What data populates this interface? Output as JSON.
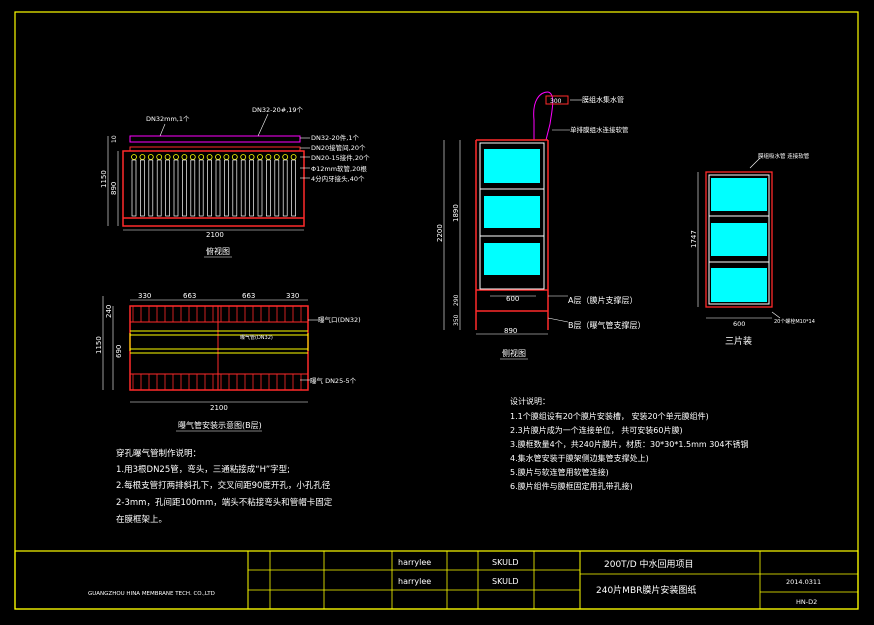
{
  "colors": {
    "frame": "#ffff00",
    "structure": "#ff2a2a",
    "text": "#ffffff",
    "membrane": "#00ffff",
    "dim": "#ffffff",
    "pipe": "#ff00ff"
  },
  "front_view": {
    "callouts": [
      "DN32mm,1个",
      "DN32-20#,19个",
      "DN32-20件,1个",
      "DN20接管间,20个",
      "DN20-15接件,20个",
      "Φ12mm软管,20根",
      "4分内牙接头,40个"
    ],
    "dim_width": "2100",
    "dim_height_outer": "1150",
    "dim_height_inner": "890",
    "dim_small": "10",
    "caption": "俯视图"
  },
  "plan_view": {
    "dims_top": [
      "330",
      "663",
      "663",
      "330"
    ],
    "dim_width": "2100",
    "dims_left": [
      "240",
      "1150",
      "690"
    ],
    "label_inlet": "曝气口(DN32)",
    "label_inner": "曝气管(DN32)",
    "label_bottom": "曝气 DN25-5个",
    "caption": "曝气管安装示意图(B层)"
  },
  "aeration_notes": {
    "title": "穿孔曝气管制作说明：",
    "lines": [
      "1.用3根DN25管，弯头，三通粘接成“H”字型;",
      "2.每根支管打两排斜孔下，交叉间距90度开孔，小孔孔径",
      "2-3mm，孔间距100mm，端头不粘接弯头和管帽卡固定",
      "在膜框架上。"
    ]
  },
  "side_view": {
    "label_top_dim": "300",
    "label_pipe": "膜组水集水管",
    "label_connector": "单排膜组水连接软管",
    "dim_total": "2200",
    "dim_upper": "1890",
    "dim_lower": "290",
    "dim_lower_small": "350",
    "dim_width_inner": "600",
    "dim_width_outer": "890",
    "label_layer_a": "A层（膜片支撑层）",
    "label_layer_b": "B层（曝气管支撑层）",
    "caption": "侧视图"
  },
  "three_panel": {
    "callout_top": "膜组吸水管\n连接软管",
    "dim_height": "1747",
    "dim_width": "600",
    "callout_bottom": "20个螺栓M10*14",
    "caption": "三片装"
  },
  "design_notes": {
    "title": "设计说明：",
    "lines": [
      "1.1个膜组设有20个膜片安装槽，  安装20个单元膜组件)",
      "2.3片膜片成为一个连接单位，  共可安装60片膜)",
      "3.膜框数量4个，共240片膜片，材质：30*30*1.5mm  304不锈钢",
      "4.集水管安装于膜架侧边集管支撑处上)",
      "5.膜片与软连管用软管连接)",
      "6.膜片组件与膜框固定用孔带孔接)"
    ]
  },
  "title_block": {
    "company": "GUANGZHOU HINA MEMBRANE TECH. CO.,LTD",
    "drafter": "harrylee",
    "checker": "harrylee",
    "skuld1": "SKULD",
    "skuld2": "SKULD",
    "project": "200T/D  中水回用项目",
    "drawing": "240片MBR膜片安装图纸",
    "date": "2014.0311",
    "number": "HN-D2"
  }
}
